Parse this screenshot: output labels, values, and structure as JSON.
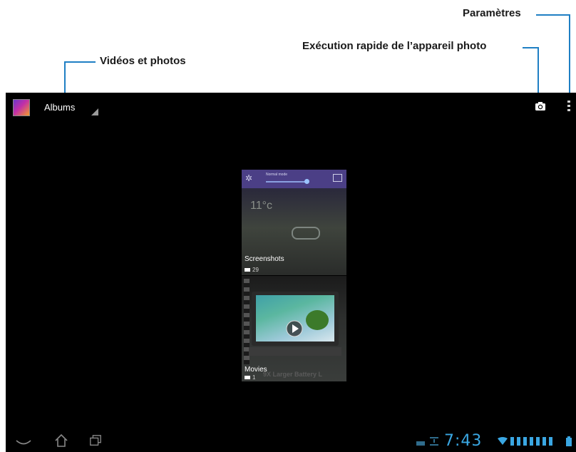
{
  "callouts": {
    "settings": "Paramètres",
    "camera_quick": "Exécution rapide de l’appareil photo",
    "videos_photos": "Vidéos et photos"
  },
  "actionbar": {
    "title": "Albums",
    "app_icon": "gallery-app-icon",
    "camera_icon": "camera-icon",
    "menu_icon": "overflow-menu-icon"
  },
  "albums": [
    {
      "name": "Screenshots",
      "count": "29"
    },
    {
      "name": "Movies",
      "count": "1"
    }
  ],
  "thumbnail_text": {
    "mode": "Normal mode",
    "temp": "11°c",
    "movie_caption": "9X Larger Battery L"
  },
  "system_bar": {
    "time": "7:43",
    "icons": [
      "back-icon",
      "home-icon",
      "recent-apps-icon",
      "keyboard-icon",
      "download-icon",
      "wifi-icon",
      "battery-icon"
    ]
  },
  "colors": {
    "callout_line": "#1f7fc4",
    "clock": "#3aa7e3",
    "screen_bg": "#000000"
  }
}
